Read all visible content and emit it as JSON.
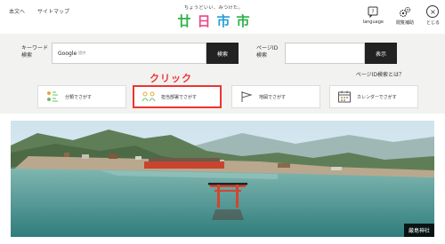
{
  "header": {
    "topnav": [
      "本文へ",
      "サイトマップ"
    ],
    "tagline": "ちょうどいい、みつけた。",
    "logo": [
      "廿",
      "日",
      "市",
      "市"
    ],
    "logo_colors": [
      "#2db34a",
      "#e94b8a",
      "#29a0d8",
      "#2db34a"
    ],
    "utilities": [
      {
        "label": "language",
        "icon": "language-icon"
      },
      {
        "label": "閲覧補助",
        "icon": "gear-icon"
      }
    ],
    "menu_label": "とじる",
    "menu_icon": "close-icon"
  },
  "search": {
    "keyword_label": [
      "キーワード",
      "検索"
    ],
    "keyword_engine": "Google",
    "keyword_engine_sub": "提供",
    "keyword_button": "検索",
    "pageid_label": [
      "ページID",
      "検索"
    ],
    "pageid_button": "表示",
    "pageid_help": "ページID検索とは？"
  },
  "annotation": {
    "text": "クリック",
    "color": "#e33333"
  },
  "categories": [
    {
      "label": "分類でさがす",
      "icon": "category-icon"
    },
    {
      "label": "担当部署でさがす",
      "icon": "department-icon"
    },
    {
      "label": "地図でさがす",
      "icon": "map-flag-icon"
    },
    {
      "label": "カレンダーでさがす",
      "icon": "calendar-icon"
    }
  ],
  "photo": {
    "caption": "厳島神社"
  }
}
